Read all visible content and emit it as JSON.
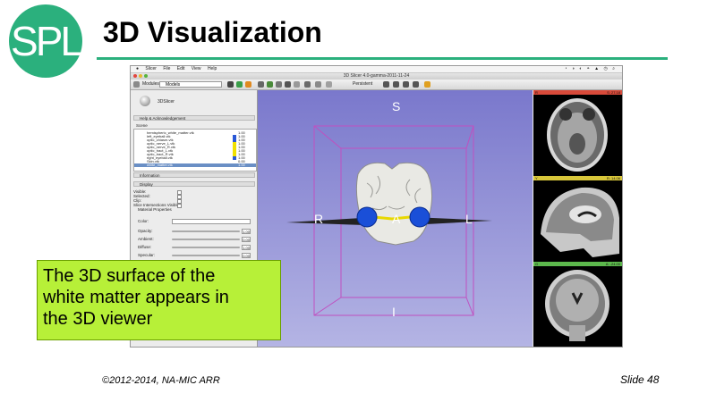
{
  "logo": {
    "text": "SPL"
  },
  "slide_title": "3D Visualization",
  "callout_lines": [
    "The 3D surface of the",
    "white matter appears in",
    "the 3D viewer"
  ],
  "footer": {
    "copyright": "©2012-2014, NA-MIC ARR",
    "slide_number": "Slide 48"
  },
  "screenshot": {
    "menubar": [
      "Slicer",
      "File",
      "Edit",
      "View",
      "Help"
    ],
    "window_title": "3D Slicer 4.0-gamma-2011-11-24",
    "toolbar": {
      "modules_label": "Modules:",
      "module_selected": "Models",
      "persistent_label": "Persistent"
    },
    "module_panel": {
      "logo_text": "3DSlicer",
      "help_section": "Help & Acknowledgement",
      "scene_label": "Scene",
      "tree_items": [
        {
          "name": "hemispheric_white_matter.vtk",
          "value": "1.00",
          "swatch": ""
        },
        {
          "name": "left_eyeball.vtk",
          "value": "1.00",
          "swatch": "#2a58d6"
        },
        {
          "name": "optic_chiasm.vtk",
          "value": "1.00",
          "swatch": "#2a58d6"
        },
        {
          "name": "optic_nerve_L.vtk",
          "value": "1.00",
          "swatch": "#f0e000"
        },
        {
          "name": "optic_nerve_R.vtk",
          "value": "1.00",
          "swatch": "#f0e000"
        },
        {
          "name": "optic_tract_L.vtk",
          "value": "1.00",
          "swatch": "#f0e000"
        },
        {
          "name": "optic_tract_R.vtk",
          "value": "1.00",
          "swatch": "#f0e000"
        },
        {
          "name": "right_eyeball.vtk",
          "value": "1.00",
          "swatch": "#2a58d6"
        },
        {
          "name": "Skin.vtk",
          "value": "0.00",
          "swatch": ""
        },
        {
          "name": "white_matter.vtk",
          "value": "1.00",
          "swatch": ""
        }
      ],
      "information_section": "Information",
      "display_section": "Display",
      "display_flags": [
        "Visible:",
        "Selected:",
        "Clip:",
        "Slice Intersections Visible:"
      ],
      "material_label": "Material Properties",
      "color_label": "Color:",
      "sliders": [
        {
          "label": "Opacity:",
          "value": "1.00"
        },
        {
          "label": "Ambient:",
          "value": "0.00"
        },
        {
          "label": "Diffuse:",
          "value": "1.00"
        },
        {
          "label": "Specular:",
          "value": "0.00"
        }
      ]
    },
    "viewer": {
      "labels": {
        "superior": "S",
        "inferior": "I",
        "right": "R",
        "anterior": "A",
        "left": "L"
      }
    },
    "slice_views": [
      {
        "name": "Red",
        "letter": "R",
        "value": "S: 27.18",
        "color": "#d84a3a"
      },
      {
        "name": "Yellow",
        "letter": "Y",
        "value": "R: 14.06",
        "color": "#d8c63a"
      },
      {
        "name": "Green",
        "letter": "G",
        "value": "A: -24.00",
        "color": "#5cb84c"
      }
    ]
  }
}
